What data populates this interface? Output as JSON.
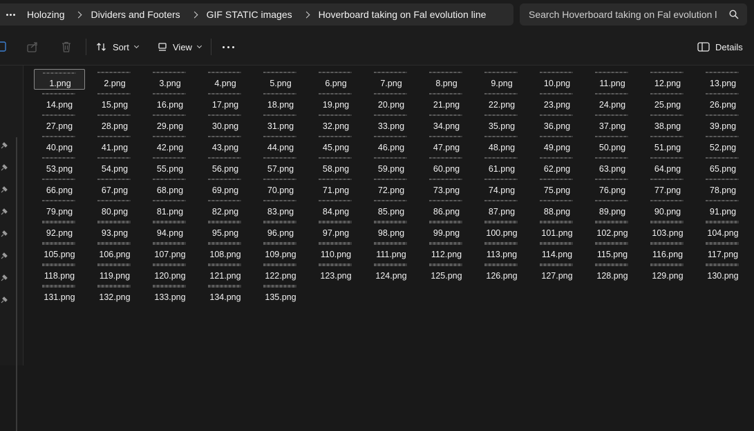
{
  "breadcrumb": {
    "items": [
      "Holozing",
      "Dividers and Footers",
      "GIF STATIC images",
      "Hoverboard taking on Fal evolution line"
    ]
  },
  "search": {
    "placeholder": "Search Hoverboard taking on Fal evolution l"
  },
  "toolbar": {
    "sort_label": "Sort",
    "view_label": "View",
    "details_label": "Details"
  },
  "files": [
    "1.png",
    "2.png",
    "3.png",
    "4.png",
    "5.png",
    "6.png",
    "7.png",
    "8.png",
    "9.png",
    "10.png",
    "11.png",
    "12.png",
    "13.png",
    "14.png",
    "15.png",
    "16.png",
    "17.png",
    "18.png",
    "19.png",
    "20.png",
    "21.png",
    "22.png",
    "23.png",
    "24.png",
    "25.png",
    "26.png",
    "27.png",
    "28.png",
    "29.png",
    "30.png",
    "31.png",
    "32.png",
    "33.png",
    "34.png",
    "35.png",
    "36.png",
    "37.png",
    "38.png",
    "39.png",
    "40.png",
    "41.png",
    "42.png",
    "43.png",
    "44.png",
    "45.png",
    "46.png",
    "47.png",
    "48.png",
    "49.png",
    "50.png",
    "51.png",
    "52.png",
    "53.png",
    "54.png",
    "55.png",
    "56.png",
    "57.png",
    "58.png",
    "59.png",
    "60.png",
    "61.png",
    "62.png",
    "63.png",
    "64.png",
    "65.png",
    "66.png",
    "67.png",
    "68.png",
    "69.png",
    "70.png",
    "71.png",
    "72.png",
    "73.png",
    "74.png",
    "75.png",
    "76.png",
    "77.png",
    "78.png",
    "79.png",
    "80.png",
    "81.png",
    "82.png",
    "83.png",
    "84.png",
    "85.png",
    "86.png",
    "87.png",
    "88.png",
    "89.png",
    "90.png",
    "91.png",
    "92.png",
    "93.png",
    "94.png",
    "95.png",
    "96.png",
    "97.png",
    "98.png",
    "99.png",
    "100.png",
    "101.png",
    "102.png",
    "103.png",
    "104.png",
    "105.png",
    "106.png",
    "107.png",
    "108.png",
    "109.png",
    "110.png",
    "111.png",
    "112.png",
    "113.png",
    "114.png",
    "115.png",
    "116.png",
    "117.png",
    "118.png",
    "119.png",
    "120.png",
    "121.png",
    "122.png",
    "123.png",
    "124.png",
    "125.png",
    "126.png",
    "127.png",
    "128.png",
    "129.png",
    "130.png",
    "131.png",
    "132.png",
    "133.png",
    "134.png",
    "135.png"
  ],
  "selected_file": "1.png",
  "colors": {
    "background": "#191919",
    "bar": "#2b2b2b",
    "text": "#f2f2f2",
    "selection_border": "#8a8a8a"
  }
}
